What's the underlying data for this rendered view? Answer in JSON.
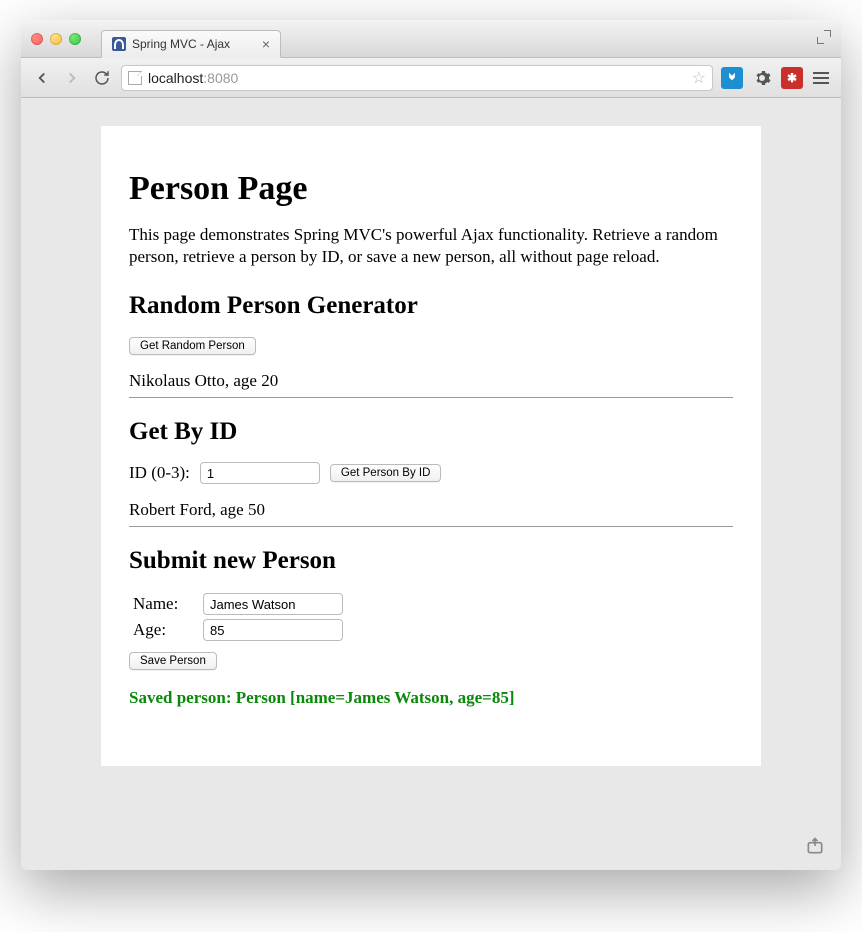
{
  "browser": {
    "tab_title": "Spring MVC - Ajax",
    "url_host": "localhost",
    "url_path": ":8080"
  },
  "page": {
    "title": "Person Page",
    "intro": "This page demonstrates Spring MVC's powerful Ajax functionality. Retrieve a random person, retrieve a person by ID, or save a new person, all without page reload."
  },
  "random": {
    "heading": "Random Person Generator",
    "button_label": "Get Random Person",
    "result": "Nikolaus Otto, age 20"
  },
  "getById": {
    "heading": "Get By ID",
    "label": "ID (0-3):",
    "value": "1",
    "button_label": "Get Person By ID",
    "result": "Robert Ford, age 50"
  },
  "submit": {
    "heading": "Submit new Person",
    "name_label": "Name:",
    "name_value": "James Watson",
    "age_label": "Age:",
    "age_value": "85",
    "button_label": "Save Person",
    "success": "Saved person: Person [name=James Watson, age=85]"
  }
}
